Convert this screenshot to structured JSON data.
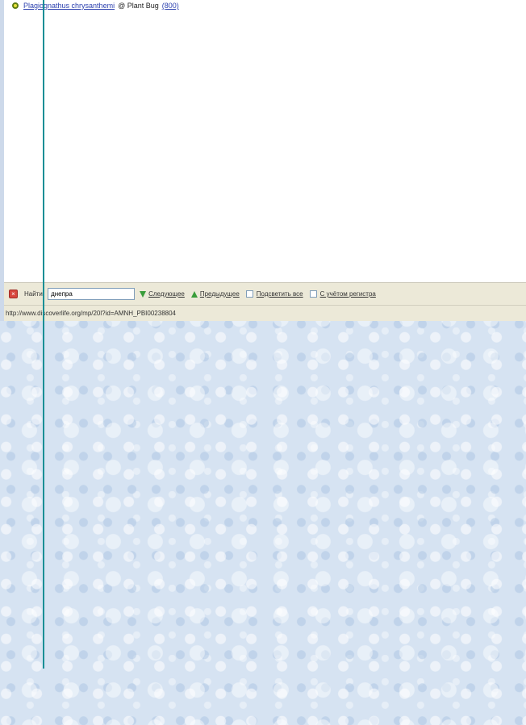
{
  "result": {
    "link_text": "Plagiognathus chrysanthemi",
    "middle_text": "@ Plant Bug",
    "count_text": "(800)"
  },
  "findbar": {
    "close_icon": "close-icon",
    "label": "Найти:",
    "input_value": "днепра",
    "next_label": "Следующее",
    "prev_label": "Предыдущее",
    "highlight_label": "Подсветить все",
    "match_case_label": "С учётом регистра"
  },
  "status": {
    "url": "http://www.discoverlife.org/mp/20l?id=AMNH_PBI00238804"
  },
  "colors": {
    "accent_line": "#1a8f96",
    "link": "#2a3fae",
    "background": "#d6e3f2"
  }
}
